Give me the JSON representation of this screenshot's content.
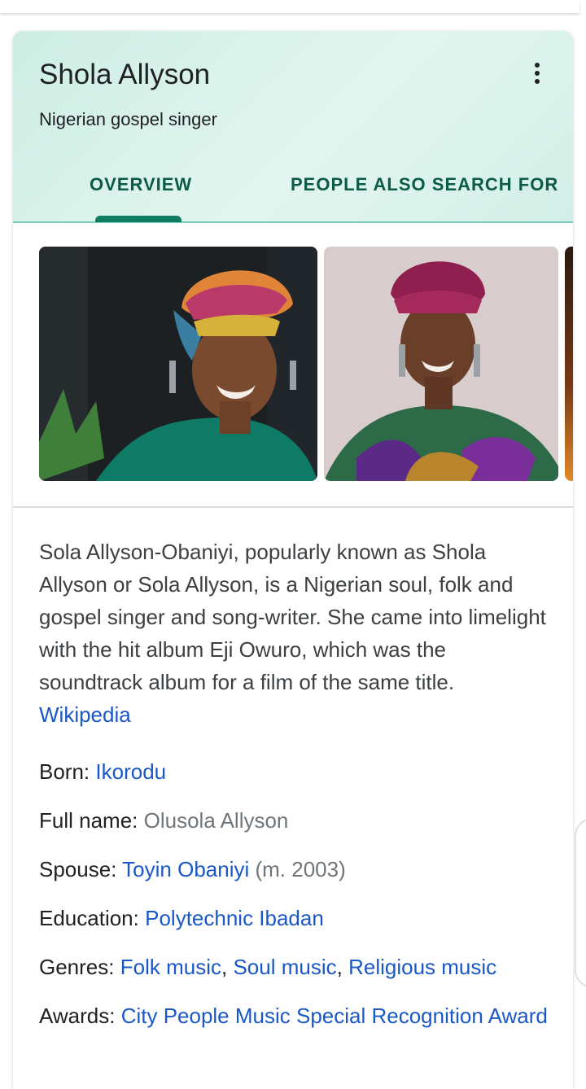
{
  "panel": {
    "title": "Shola Allyson",
    "subtitle": "Nigerian gospel singer",
    "more_icon": "more-vert-icon",
    "tabs": [
      {
        "label": "OVERVIEW",
        "selected": true
      },
      {
        "label": "PEOPLE ALSO SEARCH FOR",
        "selected": false
      }
    ],
    "accent_color": "#0f7d62",
    "link_color": "#1a57c7"
  },
  "description": {
    "text": "Sola Allyson-Obaniyi, popularly known as Shola Allyson or Sola Allyson, is a Nigerian soul, folk and gospel singer and song-writer. She came into limelight with the hit album Eji Owuro, which was the soundtrack album for a film of the same title.",
    "source_link": "Wikipedia"
  },
  "facts": {
    "born": {
      "label": "Born:",
      "value": "Ikorodu"
    },
    "full_name": {
      "label": "Full name:",
      "value": "Olusola Allyson"
    },
    "spouse": {
      "label": "Spouse:",
      "value": "Toyin Obaniyi",
      "note": "(m. 2003)"
    },
    "education": {
      "label": "Education:",
      "value": "Polytechnic Ibadan"
    },
    "genres": {
      "label": "Genres:",
      "values": [
        "Folk music",
        "Soul music",
        "Religious music"
      ],
      "separator": ","
    },
    "awards": {
      "label": "Awards:",
      "value": "City People Music Special Recognition Award"
    }
  }
}
